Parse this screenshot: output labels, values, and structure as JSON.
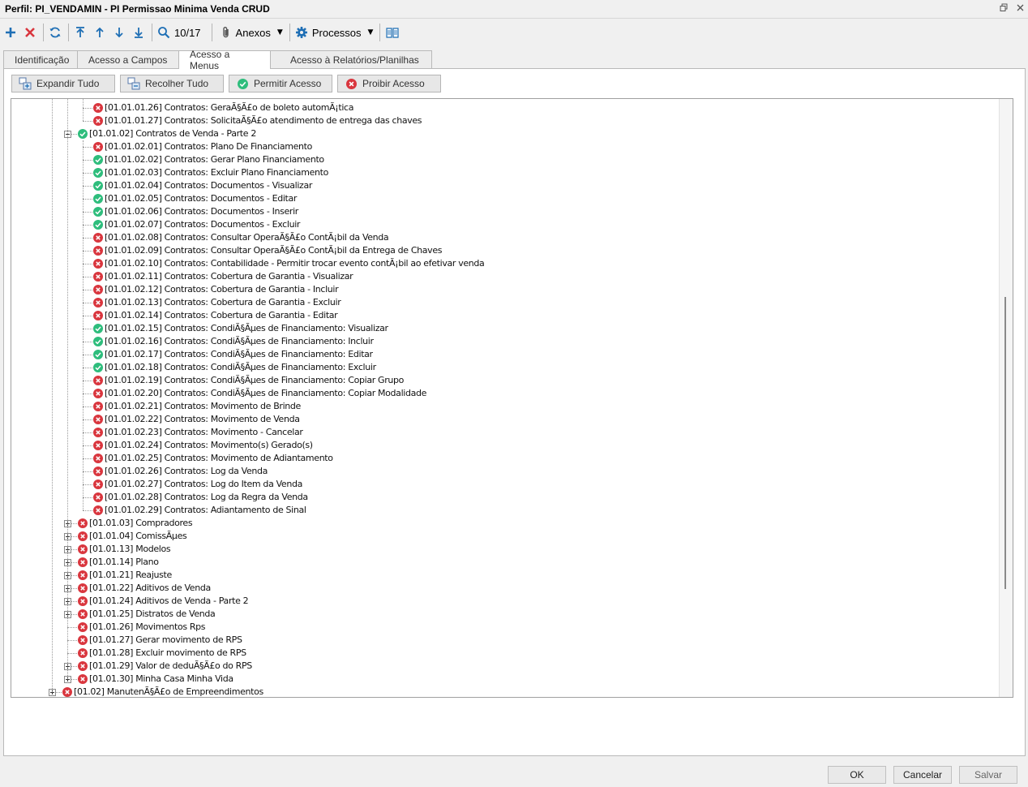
{
  "window": {
    "title": "Perfil: PI_VENDAMIN - PI Permissao Minima Venda CRUD",
    "restore_icon": "restore-icon",
    "close_icon": "close-icon"
  },
  "toolbar": {
    "record_counter": "10/17",
    "attachments_label": "Anexos",
    "processes_label": "Processos"
  },
  "tabs": [
    {
      "label": "Identificação",
      "active": false
    },
    {
      "label": "Acesso a Campos",
      "active": false
    },
    {
      "label": "Acesso a Menus",
      "active": true
    },
    {
      "label": "Acesso à Relatórios/Planilhas",
      "active": false
    }
  ],
  "actions": {
    "expand_all": "Expandir Tudo",
    "collapse_all": "Recolher Tudo",
    "allow_access": "Permitir Acesso",
    "deny_access": "Proibir Acesso"
  },
  "colors": {
    "allowed": "#2ebd7c",
    "denied": "#d9363e",
    "toolbar_icon": "#1f6fb5"
  },
  "tree": [
    {
      "level": 3,
      "status": "denied",
      "expander": "none",
      "label": "[01.01.01.26] Contratos: GeraÃ§Ã£o de boleto automÃ¡tica"
    },
    {
      "level": 3,
      "status": "denied",
      "expander": "none",
      "label": "[01.01.01.27] Contratos: SolicitaÃ§Ã£o atendimento de entrega das chaves"
    },
    {
      "level": 2,
      "status": "allowed",
      "expander": "minus",
      "label": "[01.01.02] Contratos de Venda - Parte 2"
    },
    {
      "level": 3,
      "status": "denied",
      "expander": "none",
      "label": "[01.01.02.01] Contratos: Plano De Financiamento"
    },
    {
      "level": 3,
      "status": "allowed",
      "expander": "none",
      "label": "[01.01.02.02] Contratos: Gerar Plano Financiamento"
    },
    {
      "level": 3,
      "status": "allowed",
      "expander": "none",
      "label": "[01.01.02.03] Contratos: Excluir Plano Financiamento"
    },
    {
      "level": 3,
      "status": "allowed",
      "expander": "none",
      "label": "[01.01.02.04] Contratos: Documentos - Visualizar"
    },
    {
      "level": 3,
      "status": "allowed",
      "expander": "none",
      "label": "[01.01.02.05] Contratos: Documentos - Editar"
    },
    {
      "level": 3,
      "status": "allowed",
      "expander": "none",
      "label": "[01.01.02.06] Contratos: Documentos - Inserir"
    },
    {
      "level": 3,
      "status": "allowed",
      "expander": "none",
      "label": "[01.01.02.07] Contratos: Documentos - Excluir"
    },
    {
      "level": 3,
      "status": "denied",
      "expander": "none",
      "label": "[01.01.02.08] Contratos: Consultar OperaÃ§Ã£o ContÃ¡bil da Venda"
    },
    {
      "level": 3,
      "status": "denied",
      "expander": "none",
      "label": "[01.01.02.09] Contratos: Consultar OperaÃ§Ã£o ContÃ¡bil da Entrega de Chaves"
    },
    {
      "level": 3,
      "status": "denied",
      "expander": "none",
      "label": "[01.01.02.10] Contratos: Contabilidade - Permitir trocar evento contÃ¡bil ao efetivar venda"
    },
    {
      "level": 3,
      "status": "denied",
      "expander": "none",
      "label": "[01.01.02.11] Contratos: Cobertura de Garantia - Visualizar"
    },
    {
      "level": 3,
      "status": "denied",
      "expander": "none",
      "label": "[01.01.02.12] Contratos: Cobertura de Garantia - Incluir"
    },
    {
      "level": 3,
      "status": "denied",
      "expander": "none",
      "label": "[01.01.02.13] Contratos: Cobertura de Garantia - Excluir"
    },
    {
      "level": 3,
      "status": "denied",
      "expander": "none",
      "label": "[01.01.02.14] Contratos: Cobertura de Garantia - Editar"
    },
    {
      "level": 3,
      "status": "allowed",
      "expander": "none",
      "label": "[01.01.02.15] Contratos: CondiÃ§Ãµes de Financiamento: Visualizar"
    },
    {
      "level": 3,
      "status": "allowed",
      "expander": "none",
      "label": "[01.01.02.16] Contratos: CondiÃ§Ãµes de Financiamento: Incluir"
    },
    {
      "level": 3,
      "status": "allowed",
      "expander": "none",
      "label": "[01.01.02.17] Contratos: CondiÃ§Ãµes de Financiamento: Editar"
    },
    {
      "level": 3,
      "status": "allowed",
      "expander": "none",
      "label": "[01.01.02.18] Contratos: CondiÃ§Ãµes de Financiamento: Excluir"
    },
    {
      "level": 3,
      "status": "denied",
      "expander": "none",
      "label": "[01.01.02.19] Contratos: CondiÃ§Ãµes de Financiamento: Copiar Grupo"
    },
    {
      "level": 3,
      "status": "denied",
      "expander": "none",
      "label": "[01.01.02.20] Contratos: CondiÃ§Ãµes de Financiamento: Copiar Modalidade"
    },
    {
      "level": 3,
      "status": "denied",
      "expander": "none",
      "label": "[01.01.02.21] Contratos: Movimento de Brinde"
    },
    {
      "level": 3,
      "status": "denied",
      "expander": "none",
      "label": "[01.01.02.22] Contratos: Movimento de Venda"
    },
    {
      "level": 3,
      "status": "denied",
      "expander": "none",
      "label": "[01.01.02.23] Contratos: Movimento - Cancelar"
    },
    {
      "level": 3,
      "status": "denied",
      "expander": "none",
      "label": "[01.01.02.24] Contratos: Movimento(s) Gerado(s)"
    },
    {
      "level": 3,
      "status": "denied",
      "expander": "none",
      "label": "[01.01.02.25] Contratos: Movimento de Adiantamento"
    },
    {
      "level": 3,
      "status": "denied",
      "expander": "none",
      "label": "[01.01.02.26] Contratos: Log da Venda"
    },
    {
      "level": 3,
      "status": "denied",
      "expander": "none",
      "label": "[01.01.02.27] Contratos: Log do Item da Venda"
    },
    {
      "level": 3,
      "status": "denied",
      "expander": "none",
      "label": "[01.01.02.28] Contratos: Log da Regra da Venda"
    },
    {
      "level": 3,
      "status": "denied",
      "expander": "none",
      "label": "[01.01.02.29] Contratos: Adiantamento de Sinal"
    },
    {
      "level": 2,
      "status": "denied",
      "expander": "plus",
      "label": "[01.01.03] Compradores"
    },
    {
      "level": 2,
      "status": "denied",
      "expander": "plus",
      "label": "[01.01.04] ComissÃµes"
    },
    {
      "level": 2,
      "status": "denied",
      "expander": "plus",
      "label": "[01.01.13] Modelos"
    },
    {
      "level": 2,
      "status": "denied",
      "expander": "plus",
      "label": "[01.01.14] Plano"
    },
    {
      "level": 2,
      "status": "denied",
      "expander": "plus",
      "label": "[01.01.21] Reajuste"
    },
    {
      "level": 2,
      "status": "denied",
      "expander": "plus",
      "label": "[01.01.22] Aditivos de Venda"
    },
    {
      "level": 2,
      "status": "denied",
      "expander": "plus",
      "label": "[01.01.24] Aditivos de Venda - Parte 2"
    },
    {
      "level": 2,
      "status": "denied",
      "expander": "plus",
      "label": "[01.01.25] Distratos de Venda"
    },
    {
      "level": 2,
      "status": "denied",
      "expander": "none",
      "label": "[01.01.26] Movimentos Rps"
    },
    {
      "level": 2,
      "status": "denied",
      "expander": "none",
      "label": "[01.01.27] Gerar movimento de RPS"
    },
    {
      "level": 2,
      "status": "denied",
      "expander": "none",
      "label": "[01.01.28] Excluir movimento de RPS"
    },
    {
      "level": 2,
      "status": "denied",
      "expander": "plus",
      "label": "[01.01.29] Valor de deduÃ§Ã£o do RPS"
    },
    {
      "level": 2,
      "status": "denied",
      "expander": "plus",
      "label": "[01.01.30] Minha Casa Minha Vida"
    },
    {
      "level": 1,
      "status": "denied",
      "expander": "plus",
      "label": "[01.02] ManutenÃ§Ã£o de Empreendimentos"
    }
  ],
  "footer": {
    "ok": "OK",
    "cancel": "Cancelar",
    "save": "Salvar"
  }
}
